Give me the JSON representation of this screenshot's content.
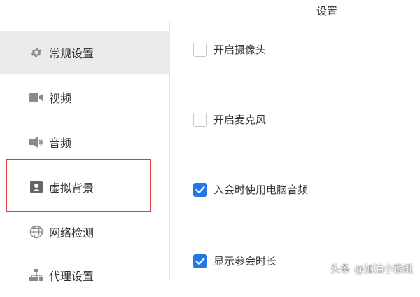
{
  "window": {
    "title": "设置"
  },
  "sidebar": {
    "items": [
      {
        "label": "常规设置",
        "icon": "gear-icon",
        "active": true
      },
      {
        "label": "视频",
        "icon": "video-camera-icon",
        "active": false
      },
      {
        "label": "音频",
        "icon": "speaker-icon",
        "active": false
      },
      {
        "label": "虚拟背景",
        "icon": "portrait-icon",
        "active": false
      },
      {
        "label": "网络检测",
        "icon": "globe-icon",
        "active": false
      },
      {
        "label": "代理设置",
        "icon": "network-tree-icon",
        "active": false
      }
    ]
  },
  "settings": {
    "options": [
      {
        "label": "开启摄像头",
        "checked": false
      },
      {
        "label": "开启麦克风",
        "checked": false
      },
      {
        "label": "入会时使用电脑音频",
        "checked": true
      },
      {
        "label": "显示参会时长",
        "checked": true
      }
    ]
  },
  "watermark": {
    "source": "头条",
    "author": "@加油小猴纸"
  },
  "colors": {
    "accent": "#2378e8",
    "highlight_border": "#e53935",
    "active_item_bg": "#ebebeb"
  }
}
